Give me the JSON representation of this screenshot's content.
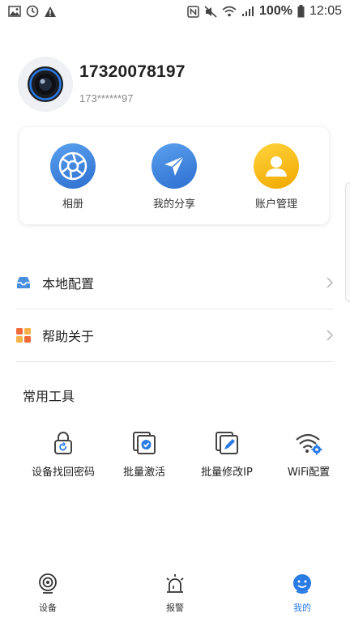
{
  "status_bar": {
    "battery": "100%",
    "time": "12:05"
  },
  "profile": {
    "phone": "17320078197",
    "masked_account": "173******97"
  },
  "quick_actions": [
    {
      "label": "相册",
      "icon": "camera-aperture-icon",
      "color": "#3a7fd8"
    },
    {
      "label": "我的分享",
      "icon": "paper-plane-icon",
      "color": "#3a7fd8"
    },
    {
      "label": "账户管理",
      "icon": "user-icon",
      "color": "#f5b301"
    }
  ],
  "menu": [
    {
      "label": "本地配置",
      "icon": "inbox-tray-icon"
    },
    {
      "label": "帮助关于",
      "icon": "grid-squares-icon"
    }
  ],
  "tools": {
    "title": "常用工具",
    "items": [
      {
        "label": "设备找回密码",
        "icon": "lock-reset-icon"
      },
      {
        "label": "批量激活",
        "icon": "batch-activate-icon"
      },
      {
        "label": "批量修改IP",
        "icon": "batch-edit-icon"
      },
      {
        "label": "WiFi配置",
        "icon": "wifi-settings-icon"
      }
    ]
  },
  "bottom_nav": [
    {
      "label": "设备",
      "icon": "camera-device-icon",
      "active": false
    },
    {
      "label": "报警",
      "icon": "alarm-siren-icon",
      "active": false
    },
    {
      "label": "我的",
      "icon": "profile-face-icon",
      "active": true
    }
  ],
  "colors": {
    "accent": "#2a7be4",
    "yellow": "#f5b301"
  }
}
